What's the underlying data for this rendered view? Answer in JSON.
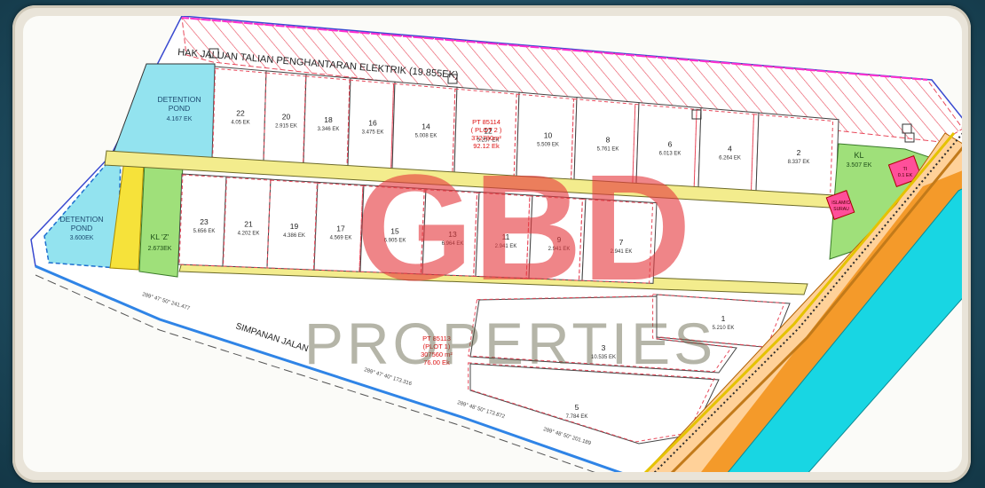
{
  "map": {
    "easement_label": "HAK    JALUAN   TALIAN         PENGHANTARAN  ELEKTRIK (19.855EK)",
    "road_label": "SIMPANAN   JALAN",
    "watermark_logo": "GBD",
    "watermark_text": "PROPERTIES",
    "detention_pond_1": [
      "DETENTION",
      "POND",
      "4.167 EK"
    ],
    "detention_pond_2": [
      "DETENTION",
      "POND",
      "3.600EK"
    ],
    "kl_z": [
      "KL 'Z'",
      "2.673EK"
    ],
    "kl_top": [
      "KL",
      "3.507 EK"
    ],
    "ti_label": [
      "TI",
      "0.1 EK"
    ],
    "surau_label": [
      "ISLAMIC/",
      "SURAU"
    ],
    "plot1": [
      "PT 85113",
      "(PLOT 1)",
      "307560 m²",
      "76.00 Ek"
    ],
    "plot2": [
      "PT 85114",
      "( PLOT 2 )",
      "372780m²",
      "92.12 Ek"
    ],
    "bearing_1": "289°  47'  50\"  241.477",
    "bearing_2": "289°  47'  40\"  173.316",
    "bearing_3": "289°  48'  50\"  173.872",
    "bearing_4": "289°  48'  50\"  201.189",
    "lots_upper": [
      {
        "no": "22",
        "area": "4.05 EK"
      },
      {
        "no": "20",
        "area": "2.915 EK"
      },
      {
        "no": "18",
        "area": "3.346 EK"
      },
      {
        "no": "16",
        "area": "3.475 EK"
      },
      {
        "no": "14",
        "area": "5.008 EK"
      },
      {
        "no": "12",
        "area": "5.257 EK"
      },
      {
        "no": "10",
        "area": "5.509 EK"
      },
      {
        "no": "8",
        "area": "5.761 EK"
      },
      {
        "no": "6",
        "area": "6.013 EK"
      },
      {
        "no": "4",
        "area": "6.264 EK"
      },
      {
        "no": "2",
        "area": "8.337 EK"
      }
    ],
    "lots_lower": [
      {
        "no": "23",
        "area": "5.656 EK"
      },
      {
        "no": "21",
        "area": "4.202 EK"
      },
      {
        "no": "19",
        "area": "4.386 EK"
      },
      {
        "no": "17",
        "area": "4.569 EK"
      },
      {
        "no": "15",
        "area": "6.905 EK"
      },
      {
        "no": "13",
        "area": "6.964 EK"
      },
      {
        "no": "11",
        "area": "2.941 EK"
      },
      {
        "no": "9",
        "area": "2.941 EK"
      },
      {
        "no": "7",
        "area": "2.941 EK"
      },
      {
        "no": "1",
        "area": "5.210 EK"
      },
      {
        "no": "3",
        "area": "10.535 EK"
      },
      {
        "no": "5",
        "area": "7.784 EK"
      }
    ]
  },
  "colors": {
    "pond": "#93e3ef",
    "green": "#9fe07a",
    "yellow": "#f6e23a",
    "cyan": "#18d6e3",
    "easement": "#e8485a",
    "pink": "#ff3f8a",
    "watermark": "#e53a3f"
  }
}
